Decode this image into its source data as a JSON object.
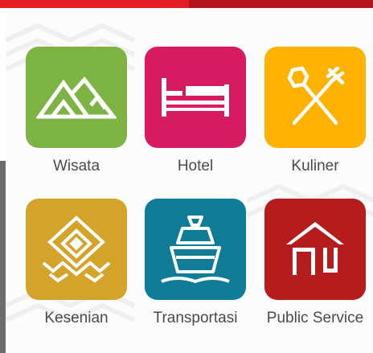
{
  "categories": [
    {
      "label": "Wisata",
      "icon": "mountains-icon",
      "color": "#7cb342"
    },
    {
      "label": "Hotel",
      "icon": "bed-icon",
      "color": "#d81b60"
    },
    {
      "label": "Kuliner",
      "icon": "spoon-fork-icon",
      "color": "#ffb300"
    },
    {
      "label": "Kesenian",
      "icon": "art-diamond-icon",
      "color": "#d4a32a"
    },
    {
      "label": "Transportasi",
      "icon": "ship-icon",
      "color": "#0e7c96"
    },
    {
      "label": "Public Service",
      "icon": "building-icon",
      "color": "#b71c1c"
    }
  ],
  "colors": {
    "topbar": "#e31e24",
    "label_text": "#4a4a4a",
    "background": "#fcfcfc"
  }
}
